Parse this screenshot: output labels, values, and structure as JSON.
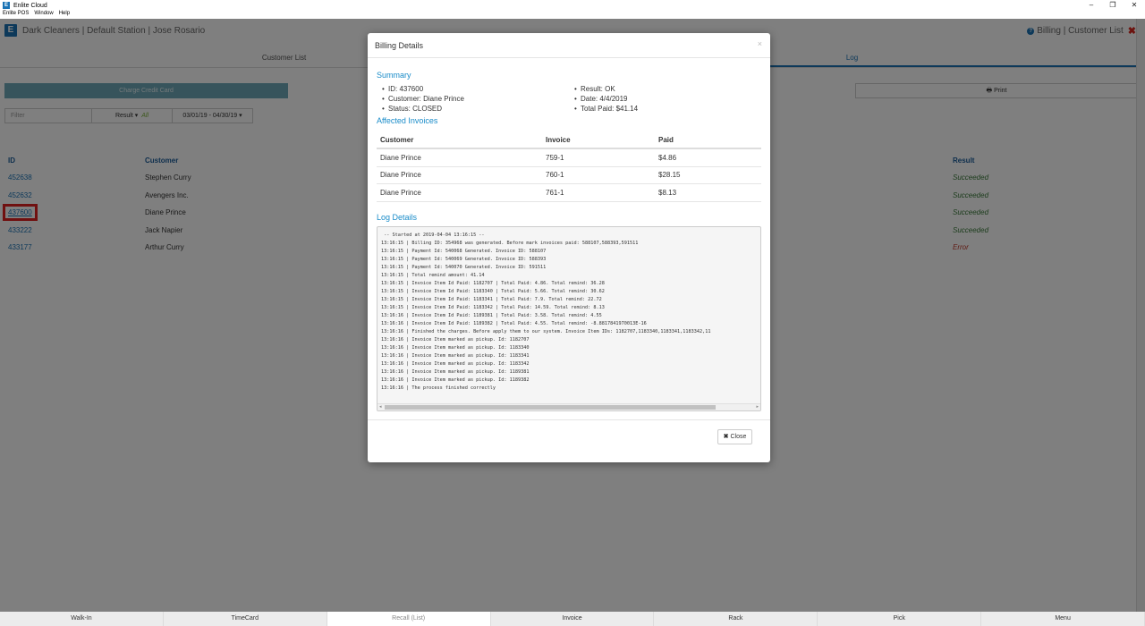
{
  "window": {
    "title": "Enlite Cloud",
    "menu": [
      "Enlite POS",
      "Window",
      "Help"
    ],
    "controls": [
      "–",
      "❐",
      "✕"
    ]
  },
  "header": {
    "logo_letter": "E",
    "title": "Dark Cleaners | Default Station | Jose Rosario",
    "breadcrumb": "Billing | Customer List"
  },
  "tabs": [
    {
      "label": "Customer List",
      "active": false
    },
    {
      "label": "Log",
      "active": true
    }
  ],
  "toolbar": {
    "charge_label": "Charge Credit Card",
    "print_label": "Print"
  },
  "filters": {
    "filter_placeholder": "Filter",
    "result_label": "Result",
    "result_value": "All",
    "date_range": "03/01/19 - 04/30/19"
  },
  "table": {
    "headers": {
      "id": "ID",
      "customer": "Customer",
      "result": "Result"
    },
    "rows": [
      {
        "id": "452638",
        "customer": "Stephen Curry",
        "result": "Succeeded"
      },
      {
        "id": "452632",
        "customer": "Avengers Inc.",
        "result": "Succeeded"
      },
      {
        "id": "437600",
        "customer": "Diane Prince",
        "result": "Succeeded"
      },
      {
        "id": "433222",
        "customer": "Jack Napier",
        "result": "Succeeded"
      },
      {
        "id": "433177",
        "customer": "Arthur Curry",
        "result": "Error"
      }
    ]
  },
  "footer_nav": [
    {
      "label": "Walk-In",
      "active": false
    },
    {
      "label": "TimeCard",
      "active": false
    },
    {
      "label": "Recall (List)",
      "active": true
    },
    {
      "label": "Invoice",
      "active": false
    },
    {
      "label": "Rack",
      "active": false
    },
    {
      "label": "Pick",
      "active": false
    },
    {
      "label": "Menu",
      "active": false
    }
  ],
  "modal": {
    "title": "Billing Details",
    "close_x": "×",
    "summary_title": "Summary",
    "summary_left": [
      "ID: 437600",
      "Customer: Diane Prince",
      "Status: CLOSED"
    ],
    "summary_right": [
      "Result: OK",
      "Date: 4/4/2019",
      "Total Paid: $41.14"
    ],
    "affected_title": "Affected Invoices",
    "invoice_headers": {
      "customer": "Customer",
      "invoice": "Invoice",
      "paid": "Paid"
    },
    "invoices": [
      {
        "customer": "Diane Prince",
        "invoice": "759-1",
        "paid": "$4.86"
      },
      {
        "customer": "Diane Prince",
        "invoice": "760-1",
        "paid": "$28.15"
      },
      {
        "customer": "Diane Prince",
        "invoice": "761-1",
        "paid": "$8.13"
      }
    ],
    "log_title": "Log Details",
    "log_lines": [
      " -- Started at 2019-04-04 13:16:15 --",
      "13:16:15 | Billing ID: 354968 was generated. Before mark invoices paid: 588107,588393,591511",
      "13:16:15 | Payment Id: 540068 Generated. Invoice ID: 588107",
      "13:16:15 | Payment Id: 540069 Generated. Invoice ID: 588393",
      "13:16:15 | Payment Id: 540070 Generated. Invoice ID: 591511",
      "13:16:15 | Total remind amount: 41.14",
      "13:16:15 | Invoice Item Id Paid: 1182707 | Total Paid: 4.86. Total remind: 36.28",
      "13:16:15 | Invoice Item Id Paid: 1183340 | Total Paid: 5.66. Total remind: 30.62",
      "13:16:15 | Invoice Item Id Paid: 1183341 | Total Paid: 7.9. Total remind: 22.72",
      "13:16:15 | Invoice Item Id Paid: 1183342 | Total Paid: 14.59. Total remind: 8.13",
      "13:16:16 | Invoice Item Id Paid: 1189381 | Total Paid: 3.58. Total remind: 4.55",
      "13:16:16 | Invoice Item Id Paid: 1189382 | Total Paid: 4.55. Total remind: -8.8817841970013E-16",
      "13:16:16 | Finished the charges. Before apply them to our system. Invoice Item IDs: 1182707,1183340,1183341,1183342,11",
      "13:16:16 | Invoice Item marked as pickup. Id: 1182707",
      "13:16:16 | Invoice Item marked as pickup. Id: 1183340",
      "13:16:16 | Invoice Item marked as pickup. Id: 1183341",
      "13:16:16 | Invoice Item marked as pickup. Id: 1183342",
      "13:16:16 | Invoice Item marked as pickup. Id: 1189381",
      "13:16:16 | Invoice Item marked as pickup. Id: 1189382",
      "13:16:16 | The process finished correctly"
    ],
    "close_label": "Close"
  }
}
